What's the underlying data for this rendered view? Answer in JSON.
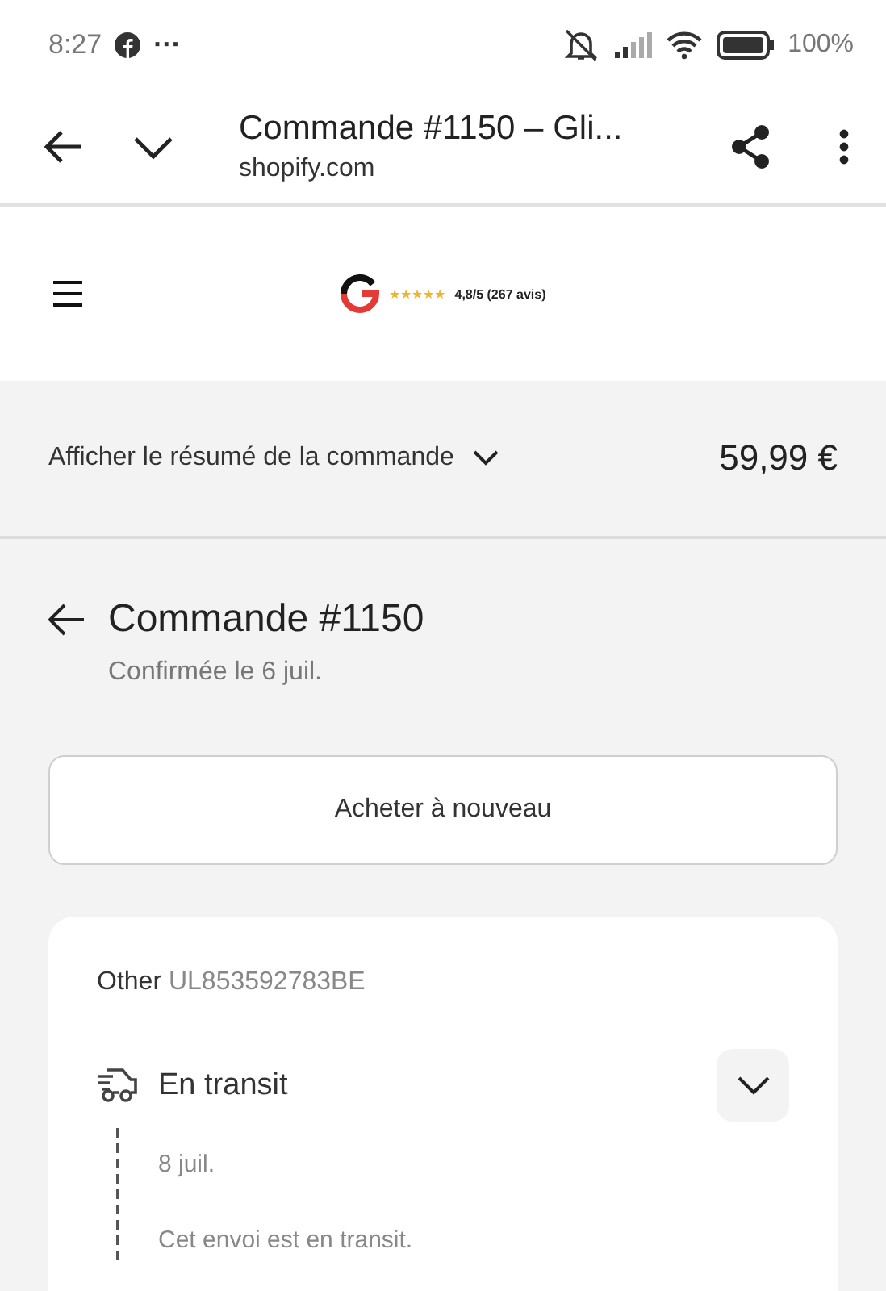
{
  "status_bar": {
    "time": "8:27",
    "more": "···",
    "battery": "100%"
  },
  "browser": {
    "title": "Commande #1150 – Gli...",
    "domain": "shopify.com"
  },
  "store": {
    "stars": 5,
    "rating": "4,8/5 (267 avis)"
  },
  "summary": {
    "label": "Afficher le résumé de la commande",
    "expanded": false,
    "total": "59,99 €"
  },
  "order": {
    "title": "Commande #1150",
    "confirmed": "Confirmée le 6 juil.",
    "reorder": "Acheter à nouveau"
  },
  "shipment": {
    "carrier": "Other",
    "tracking": "UL853592783BE",
    "status": "En transit",
    "expanded": false,
    "events": [
      {
        "date": "8 juil.",
        "message": "Cet envoi est en transit."
      }
    ]
  }
}
